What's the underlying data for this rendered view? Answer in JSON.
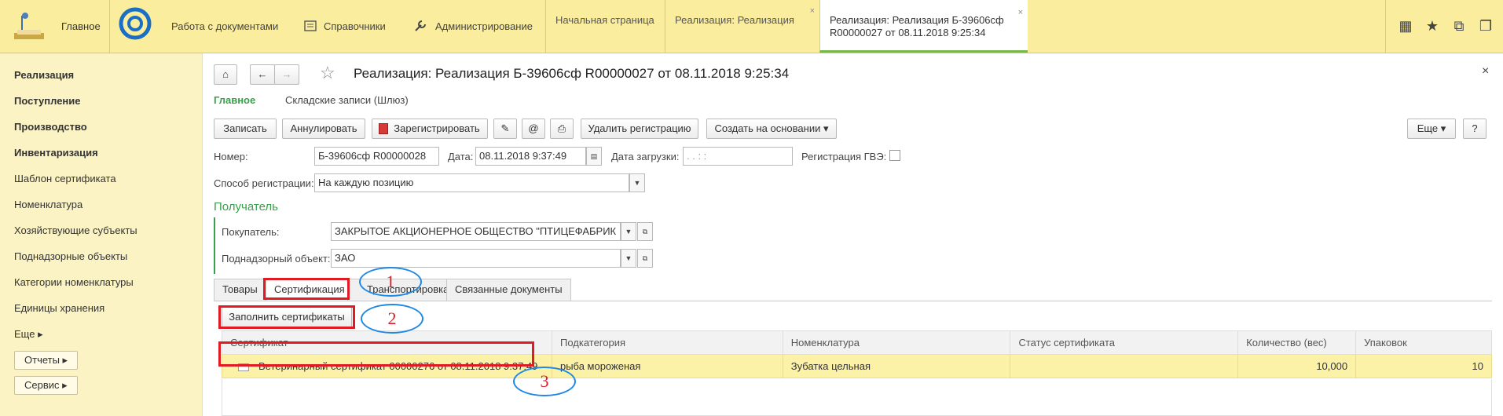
{
  "topbar": {
    "home_label": "Главное",
    "sections": [
      {
        "label": "Работа с документами",
        "icon": "circle-logo-icon"
      },
      {
        "label": "Справочники",
        "icon": "list-icon"
      },
      {
        "label": "Администрирование",
        "icon": "wrench-icon"
      }
    ],
    "tabs": [
      {
        "label": "Начальная страница"
      },
      {
        "label": "Реализация: Реализация"
      },
      {
        "label_line1": "Реализация: Реализация Б-39606сф",
        "label_line2": "R00000027 от 08.11.2018 9:25:34"
      }
    ],
    "right_icons": [
      "grid-icon",
      "star-icon",
      "history-icon",
      "restore-icon"
    ],
    "close_glyph": "×"
  },
  "sidebar": {
    "items": [
      {
        "label": "Реализация",
        "bold": true
      },
      {
        "label": "Поступление",
        "bold": true
      },
      {
        "label": "Производство",
        "bold": true
      },
      {
        "label": "Инвентаризация",
        "bold": true
      },
      {
        "label": "Шаблон сертификата",
        "bold": false
      },
      {
        "label": "Номенклатура",
        "bold": false
      },
      {
        "label": "Хозяйствующие субъекты",
        "bold": false
      },
      {
        "label": "Поднадзорные объекты",
        "bold": false
      },
      {
        "label": "Категории номенклатуры",
        "bold": false
      },
      {
        "label": "Единицы хранения",
        "bold": false
      },
      {
        "label": "Еще ▸",
        "bold": false
      }
    ],
    "buttons": [
      {
        "label": "Отчеты ▸"
      },
      {
        "label": "Сервис ▸"
      }
    ]
  },
  "doc": {
    "title": "Реализация: Реализация Б-39606сф  R00000027 от 08.11.2018 9:25:34",
    "close": "×",
    "subnav": {
      "main": "Главное",
      "secondary": "Складские записи (Шлюз)"
    },
    "toolbar": {
      "save": "Записать",
      "cancel": "Аннулировать",
      "register": "Зарегистрировать",
      "email": "@",
      "remove_registration": "Удалить регистрацию",
      "create_based": "Создать на основании ▾",
      "more": "Еще ▾",
      "help": "?"
    },
    "fields": {
      "number_label": "Номер:",
      "number_value": "Б-39606сф  R00000028",
      "date_label": "Дата:",
      "date_value": "08.11.2018  9:37:49",
      "load_date_label": "Дата загрузки:",
      "load_date_value": "  .   .        :   :",
      "gve_label": "Регистрация ГВЭ:",
      "reg_method_label": "Способ регистрации:",
      "reg_method_value": "На каждую позицию"
    },
    "recipient": {
      "heading": "Получатель",
      "buyer_label": "Покупатель:",
      "buyer_value": "ЗАКРЫТОЕ АКЦИОНЕРНОЕ ОБЩЕСТВО \"ПТИЦЕФАБРИК",
      "object_label": "Поднадзорный объект:",
      "object_value": "ЗАО"
    },
    "tabs": [
      {
        "label": "Товары"
      },
      {
        "label": "Сертификация"
      },
      {
        "label": "Транспортировка"
      },
      {
        "label": "Связанные документы"
      }
    ],
    "fill_button": "Заполнить сертификаты",
    "table": {
      "headers": [
        "Сертификат",
        "Подкатегория",
        "Номенклатура",
        "Статус сертификата",
        "Количество (вес)",
        "Упаковок"
      ],
      "rows": [
        [
          "Ветеринарный сертификат 00000276 от 08.11.2018 9:37:49",
          "рыба мороженая",
          "Зубатка цельная",
          "",
          "10,000",
          "10"
        ]
      ]
    },
    "annotations": [
      "1",
      "2",
      "3"
    ]
  },
  "colors": {
    "accent": "#3a9f4a",
    "marker": "#e01b24",
    "oval": "#1e88e5",
    "topbar": "#fbed9e",
    "row": "#fbf2a8"
  }
}
